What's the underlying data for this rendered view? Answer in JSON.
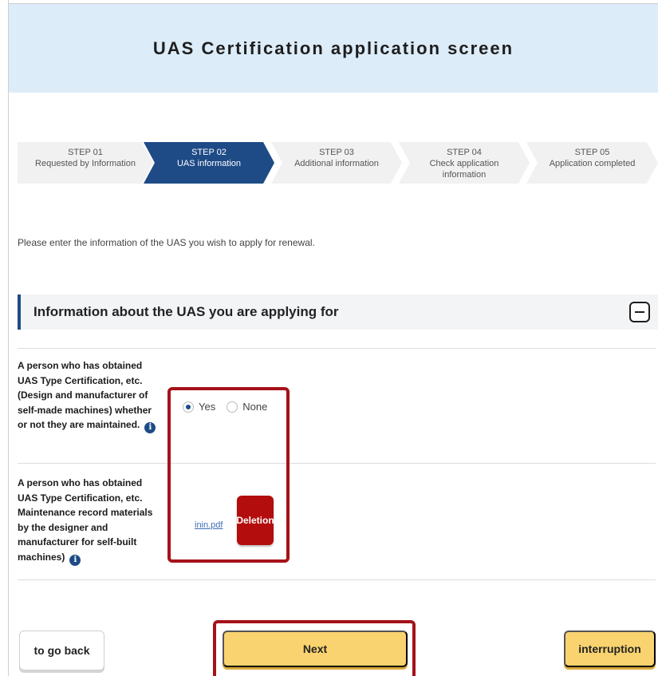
{
  "header": {
    "title": "UAS Certification application screen"
  },
  "steps": [
    {
      "num": "STEP 01",
      "label": "Requested by Information"
    },
    {
      "num": "STEP 02",
      "label": "UAS information"
    },
    {
      "num": "STEP 03",
      "label": "Additional information"
    },
    {
      "num": "STEP 04",
      "label": "Check application information"
    },
    {
      "num": "STEP 05",
      "label": "Application completed"
    }
  ],
  "active_step": 2,
  "intro_text": "Please enter the information of the UAS you wish to apply for renewal.",
  "section": {
    "title": "Information about the UAS you are applying for",
    "rows": [
      {
        "label": "A person who has obtained UAS Type Certification, etc. (Design and manufacturer of self-made machines) whether or not they are maintained.",
        "options": [
          "Yes",
          "None"
        ],
        "selected": "Yes"
      },
      {
        "label": "A person who has obtained UAS Type Certification, etc. Maintenance record materials by the designer and manufacturer for self-built machines)",
        "file_name": "inin.pdf",
        "delete_label": "Deletion"
      }
    ]
  },
  "buttons": {
    "back": "to go back",
    "next": "Next",
    "interrupt": "interruption"
  },
  "colors": {
    "accent": "#1e4b86",
    "header_bg": "#dcecf8",
    "highlight": "#a5121a",
    "primary_button": "#f9d36f",
    "delete_button": "#b30d0d"
  },
  "icons": {
    "info": "info-icon",
    "collapse": "minus-box-icon"
  }
}
